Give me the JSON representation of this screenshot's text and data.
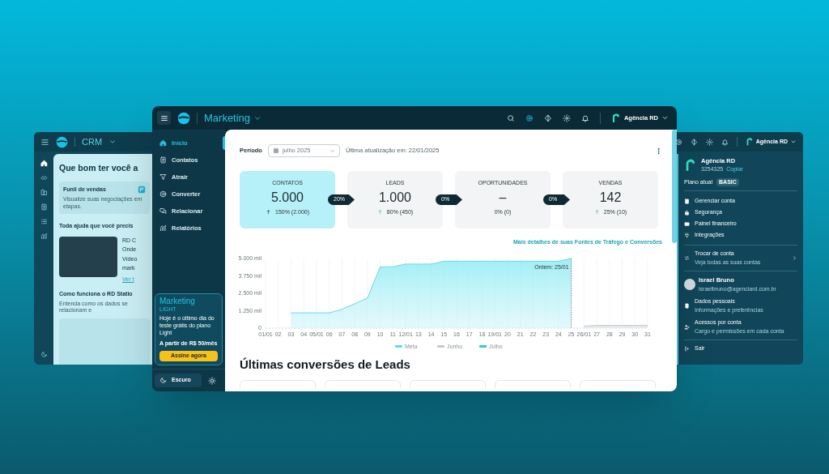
{
  "crm_window": {
    "title": "CRM",
    "greeting": "Que bom ter você a",
    "feature_card": {
      "title": "Funil de vendas",
      "description": "Visualize suas negociações em etapas."
    },
    "help_heading": "Toda ajuda que você precis",
    "video_side": [
      "RD C",
      "Onde",
      "Vídeo",
      "mark"
    ],
    "video_link": "Ver t",
    "how_heading": "Como funciona o RD Statio",
    "how_text": "Entenda como os dados se relacionam e"
  },
  "main_window": {
    "product": "Marketing",
    "account": "Agência RD",
    "sidebar": {
      "items": [
        {
          "label": "Início",
          "selected": true
        },
        {
          "label": "Contatos",
          "selected": false
        },
        {
          "label": "Atrair",
          "selected": false
        },
        {
          "label": "Converter",
          "selected": false
        },
        {
          "label": "Relacionar",
          "selected": false
        },
        {
          "label": "Relatórios",
          "selected": false
        }
      ],
      "promo": {
        "title": "Marketing",
        "plan": "LIGHT",
        "text": "Hoje é o último dia do teste grátis do plano Light",
        "price": "A partir de R$ 50/mês",
        "button": "Assine agora"
      },
      "theme_button": "Escuro"
    },
    "period_label": "Período",
    "period_value": "julho 2025",
    "last_update": "Última atualização em: 22/01/2025",
    "cards": [
      {
        "label": "CONTATOS",
        "value": "5.000",
        "change": "150% (2.000)",
        "rising": true,
        "selected": true
      },
      {
        "label": "LEADS",
        "value": "1.000",
        "change": "80% (450)",
        "rising": true,
        "selected": false
      },
      {
        "label": "OPORTUNIDADES",
        "value": "–",
        "change": "0% (0)",
        "rising": false,
        "selected": false
      },
      {
        "label": "VENDAS",
        "value": "142",
        "change": "25% (10)",
        "rising": true,
        "selected": false
      }
    ],
    "rates": [
      "20%",
      "0%",
      "0%"
    ],
    "details_link": "Mais detalhes de suas Fontes de Tráfego e Conversões",
    "chart_data": {
      "type": "area",
      "grid": true,
      "legend": "bottom",
      "categories": [
        "01/01",
        "02",
        "03",
        "04",
        "05/01",
        "06",
        "07",
        "08",
        "09",
        "10",
        "11",
        "12/01",
        "13",
        "14",
        "15",
        "16",
        "17",
        "18",
        "19/01",
        "20",
        "21",
        "22",
        "23",
        "24",
        "25",
        "26/01",
        "27",
        "28",
        "29",
        "30",
        "31"
      ],
      "yticks": [
        {
          "value": 0,
          "label": "0"
        },
        {
          "value": 1250,
          "label": "1.250 mil"
        },
        {
          "value": 2500,
          "label": "2.500 mil"
        },
        {
          "value": 3750,
          "label": "3.750 mil"
        },
        {
          "value": 5000,
          "label": "5.000 mil"
        }
      ],
      "ylim": [
        0,
        5000
      ],
      "series": [
        {
          "name": "Meta",
          "color": "#67d8e6",
          "values": [
            null,
            null,
            1100,
            1100,
            1100,
            1100,
            1350,
            1750,
            2150,
            4400,
            4400,
            4600,
            4600,
            4600,
            4800,
            4800,
            4800,
            4800,
            4800,
            4800,
            4800,
            4800,
            4800,
            4800,
            5000,
            null,
            null,
            null,
            null,
            null,
            null
          ]
        },
        {
          "name": "Junho",
          "color": "#c4c9cc",
          "values": [
            null,
            null,
            null,
            null,
            null,
            null,
            null,
            null,
            null,
            null,
            null,
            null,
            null,
            null,
            null,
            null,
            null,
            null,
            null,
            null,
            null,
            null,
            null,
            null,
            null,
            150,
            200,
            200,
            200,
            200,
            200
          ]
        },
        {
          "name": "Julho",
          "color": "#22d3c5",
          "values": [
            null,
            null,
            null,
            null,
            null,
            null,
            null,
            null,
            null,
            null,
            null,
            null,
            null,
            null,
            null,
            null,
            null,
            null,
            null,
            null,
            null,
            null,
            null,
            null,
            null,
            null,
            null,
            null,
            null,
            null,
            null
          ]
        }
      ],
      "ref_lines": [
        {
          "axis": "x",
          "value": "25",
          "label": "Ontem: 25/01"
        }
      ]
    },
    "conversions_heading": "Últimas conversões de Leads"
  },
  "account_window": {
    "account": "Agência RD",
    "menu": {
      "name": "Agência RD",
      "id": "3254325",
      "copy": "Copiar",
      "plan_label": "Plano atual",
      "plan": "BASIC",
      "items": [
        "Gerenciar conta",
        "Segurança",
        "Painel financeiro",
        "Integrações"
      ],
      "switch": {
        "title": "Trocar de conta",
        "subtitle": "Veja todas as suas contas"
      },
      "user": {
        "name": "Israel Bruno",
        "email": "israelbruno@agenciard.com.br"
      },
      "user_items": [
        {
          "title": "Dados pessoais",
          "subtitle": "Informações e preferências"
        },
        {
          "title": "Acessos por conta",
          "subtitle": "Cargo e permissões em cada conta"
        }
      ],
      "logout": "Sair"
    }
  }
}
